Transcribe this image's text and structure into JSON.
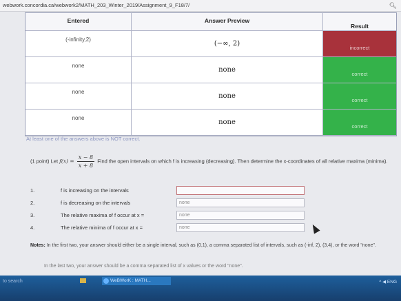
{
  "browser": {
    "url": "webwork.concordia.ca/webwork2/MATH_203_Winter_2019/Assignment_9_F18/7/",
    "zoom_icon": "zoom-icon"
  },
  "results_table": {
    "headers": {
      "entered": "Entered",
      "preview": "Answer Preview",
      "result": "Result"
    },
    "rows": [
      {
        "entered": "(-infinity,2)",
        "preview": "(−∞, 2)",
        "result": "incorrect",
        "status_color": "#a8323b"
      },
      {
        "entered": "none",
        "preview": "none",
        "result": "correct",
        "status_color": "#34b24a"
      },
      {
        "entered": "none",
        "preview": "none",
        "result": "correct",
        "status_color": "#34b24a"
      },
      {
        "entered": "none",
        "preview": "none",
        "result": "correct",
        "status_color": "#34b24a"
      }
    ]
  },
  "warning": "At least one of the answers above is NOT correct.",
  "problem": {
    "points": "(1 point) Let",
    "fx": "f(x) =",
    "numerator": "x − 8",
    "denominator": "x + 8",
    "text": "Find the open intervals on which f is increasing (decreasing). Then determine the x-coordinates of all relative maxima (minima)."
  },
  "questions": [
    {
      "num": "1.",
      "text": "f is increasing on the intervals",
      "value": "",
      "placeholder": ""
    },
    {
      "num": "2.",
      "text": "f is decreasing on the intervals",
      "value": "none",
      "placeholder": ""
    },
    {
      "num": "3.",
      "text": "The relative maxima of f occur at x =",
      "value": "none",
      "placeholder": ""
    },
    {
      "num": "4.",
      "text": "The relative minima of f occur at x =",
      "value": "none",
      "placeholder": ""
    }
  ],
  "notes": {
    "label": "Notes:",
    "text": "In the first two, your answer should either be a single interval, such as (0,1), a comma separated list of intervals, such as (-inf, 2), (3,4), or the word \"none\".",
    "cutoff": "In the last two, your answer should be a comma separated list of x values or the word \"none\"."
  },
  "taskbar": {
    "search": "to search",
    "app_label": "WeBWorK : MATH...",
    "tray": "^  ◀  ENG"
  }
}
